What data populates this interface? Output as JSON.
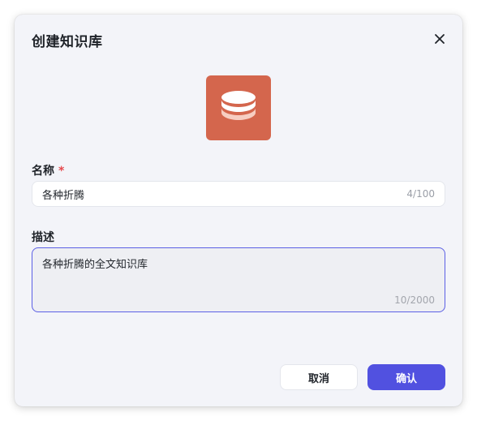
{
  "dialog": {
    "title": "创建知识库",
    "close_icon": "close-icon",
    "cover_icon": "database-icon",
    "cover_color": "#d4664d"
  },
  "form": {
    "name": {
      "label": "名称",
      "required_mark": "*",
      "value": "各种折腾",
      "counter": "4/100"
    },
    "description": {
      "label": "描述",
      "value": "各种折腾的全文知识库",
      "counter": "10/2000"
    }
  },
  "actions": {
    "cancel_label": "取消",
    "confirm_label": "确认",
    "confirm_color": "#5151e0"
  }
}
